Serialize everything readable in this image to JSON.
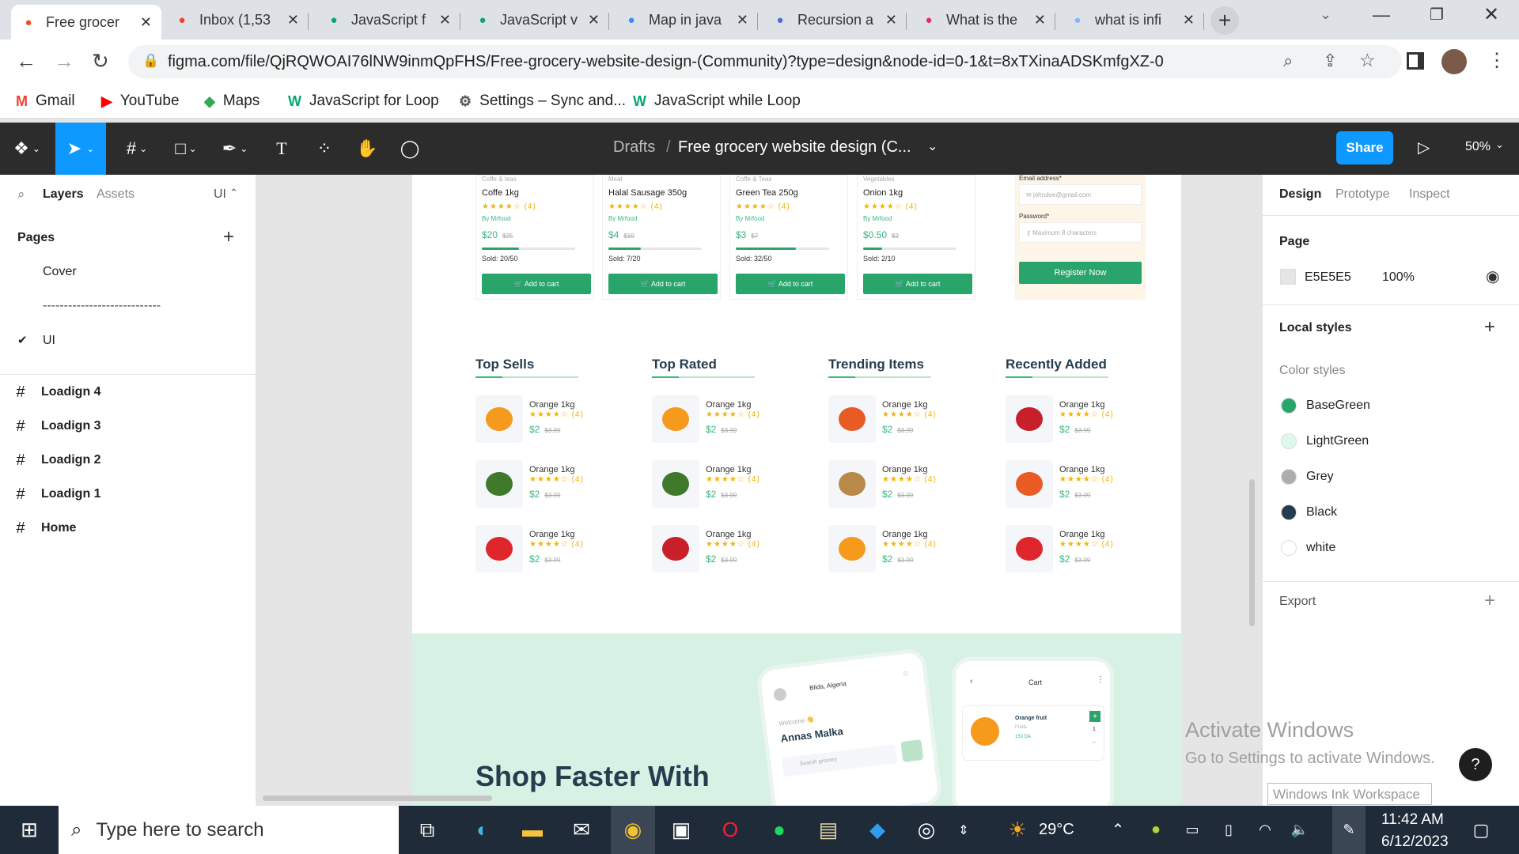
{
  "browser": {
    "tabs": [
      {
        "title": "Free grocer",
        "icon": "figma-icon",
        "color": "#f24e1e"
      },
      {
        "title": "Inbox (1,53",
        "icon": "gmail-icon",
        "color": "#ea4335"
      },
      {
        "title": "JavaScript f",
        "icon": "w3schools-icon",
        "color": "#04aa6d"
      },
      {
        "title": "JavaScript v",
        "icon": "w3schools-icon",
        "color": "#04aa6d"
      },
      {
        "title": "Map in java",
        "icon": "google-icon",
        "color": "#4285f4"
      },
      {
        "title": "Recursion a",
        "icon": "recursion-site-icon",
        "color": "#4a6ee0"
      },
      {
        "title": "What is the",
        "icon": "quizlet-icon",
        "color": "#e52b6a"
      },
      {
        "title": "what is infi",
        "icon": "loading-icon",
        "color": "#8ab4f8"
      }
    ],
    "url": "figma.com/file/QjRQWOAI76lNW9inmQpFHS/Free-grocery-website-design-(Community)?type=design&node-id=0-1&t=8xTXinaADSKmfgXZ-0",
    "bookmarks": [
      {
        "label": "Gmail",
        "icon": "gmail-icon"
      },
      {
        "label": "YouTube",
        "icon": "youtube-icon"
      },
      {
        "label": "Maps",
        "icon": "maps-icon"
      },
      {
        "label": "JavaScript for Loop",
        "icon": "w3schools-icon"
      },
      {
        "label": "Settings – Sync and...",
        "icon": "gear-icon"
      },
      {
        "label": "JavaScript while Loop",
        "icon": "w3schools-icon"
      }
    ]
  },
  "figma": {
    "breadcrumb_root": "Drafts",
    "breadcrumb_sep": "/",
    "file_title": "Free grocery website design (C...",
    "share_label": "Share",
    "zoom": "50%",
    "left": {
      "tab_layers": "Layers",
      "tab_assets": "Assets",
      "page_select": "UI",
      "pages_heading": "Pages",
      "pages": [
        "Cover",
        "----------------------------",
        "UI"
      ],
      "layers": [
        "Loadign 4",
        "Loadign 3",
        "Loadign 2",
        "Loadign 1",
        "Home"
      ]
    },
    "right": {
      "tabs": [
        "Design",
        "Prototype",
        "Inspect"
      ],
      "page_heading": "Page",
      "page_color": "E5E5E5",
      "page_opacity": "100%",
      "local_styles": "Local styles",
      "color_styles_heading": "Color styles",
      "color_styles": [
        {
          "name": "BaseGreen",
          "color": "#29a56c"
        },
        {
          "name": "LightGreen",
          "color": "#def9ec"
        },
        {
          "name": "Grey",
          "color": "#adadad"
        },
        {
          "name": "Black",
          "color": "#253d4e"
        },
        {
          "name": "white",
          "color": "#ffffff"
        }
      ],
      "export_label": "Export"
    }
  },
  "design": {
    "products": [
      {
        "category": "Coffe & teas",
        "name": "Coffe 1kg",
        "stars": "★★★★☆ (4)",
        "by": "By Mrfood",
        "price": "$20",
        "old": "$25",
        "sold": "Sold: 20/50",
        "progress": 0.4,
        "btn": "🛒 Add to cart"
      },
      {
        "category": "Meat",
        "name": "Halal Sausage 350g",
        "stars": "★★★★☆ (4)",
        "by": "By Mrfood",
        "price": "$4",
        "old": "$10",
        "sold": "Sold: 7/20",
        "progress": 0.35,
        "btn": "🛒 Add to cart"
      },
      {
        "category": "Coffe & Teas",
        "name": "Green Tea 250g",
        "stars": "★★★★☆ (4)",
        "by": "By Mrfood",
        "price": "$3",
        "old": "$7",
        "sold": "Sold: 32/50",
        "progress": 0.64,
        "btn": "🛒 Add to cart"
      },
      {
        "category": "Vegetables",
        "name": "Onion 1kg",
        "stars": "★★★★☆ (4)",
        "by": "By Mrfood",
        "price": "$0.50",
        "old": "$2",
        "sold": "Sold: 2/10",
        "progress": 0.2,
        "btn": "🛒 Add to cart"
      }
    ],
    "register": {
      "email_label": "Email address*",
      "email_placeholder": "johndoe@gmail.com",
      "password_label": "Password*",
      "password_placeholder": "Maximum 8 characters",
      "button": "Register Now"
    },
    "sections": [
      {
        "title": "Top Sells",
        "items": [
          {
            "name": "Orange 1kg",
            "price": "$2",
            "old": "$3.99",
            "fruit": "orange"
          },
          {
            "name": "Orange 1kg",
            "price": "$2",
            "old": "$3.99",
            "fruit": "broccoli"
          },
          {
            "name": "Orange 1kg",
            "price": "$2",
            "old": "$3.99",
            "fruit": "strawberry"
          }
        ]
      },
      {
        "title": "Top Rated",
        "items": [
          {
            "name": "Orange 1kg",
            "price": "$2",
            "old": "$3.99",
            "fruit": "orange"
          },
          {
            "name": "Orange 1kg",
            "price": "$2",
            "old": "$3.99",
            "fruit": "broccoli"
          },
          {
            "name": "Orange 1kg",
            "price": "$2",
            "old": "$3.99",
            "fruit": "apple"
          }
        ]
      },
      {
        "title": "Trending Items",
        "items": [
          {
            "name": "Orange 1kg",
            "price": "$2",
            "old": "$3.99",
            "fruit": "carrot"
          },
          {
            "name": "Orange 1kg",
            "price": "$2",
            "old": "$3.99",
            "fruit": "potato"
          },
          {
            "name": "Orange 1kg",
            "price": "$2",
            "old": "$3.99",
            "fruit": "orange"
          }
        ]
      },
      {
        "title": "Recently Added",
        "items": [
          {
            "name": "Orange 1kg",
            "price": "$2",
            "old": "$3.99",
            "fruit": "apple"
          },
          {
            "name": "Orange 1kg",
            "price": "$2",
            "old": "$3.99",
            "fruit": "carrot"
          },
          {
            "name": "Orange 1kg",
            "price": "$2",
            "old": "$3.99",
            "fruit": "strawberry"
          }
        ]
      }
    ],
    "mini_stars": "★★★★☆ (4)",
    "banner_heading": "Shop Faster With",
    "phone1": {
      "location": "Blida, Algeria",
      "welcome": "Welcome 👋",
      "user": "Annas Malka",
      "search": "Search grocery"
    },
    "phone2": {
      "title": "Cart",
      "item": "Orange fruit",
      "item_sub": "Fruits",
      "item_price": "150 DA",
      "qty": "1"
    }
  },
  "watermark": {
    "line1": "Activate Windows",
    "line2": "Go to Settings to activate Windows.",
    "ink": "Windows Ink Workspace"
  },
  "taskbar": {
    "search_placeholder": "Type here to search",
    "weather": "29°C",
    "time": "11:42 AM",
    "date": "6/12/2023"
  }
}
